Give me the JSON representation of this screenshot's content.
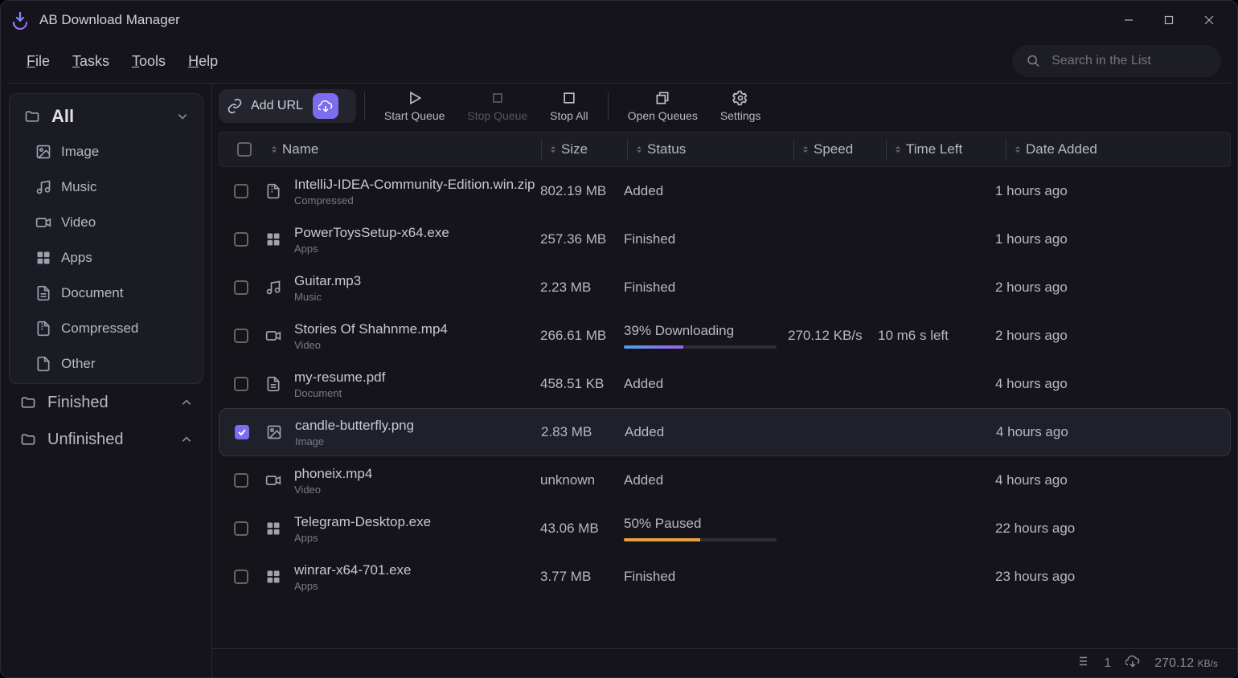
{
  "app": {
    "title": "AB Download Manager"
  },
  "menu": [
    "File",
    "Tasks",
    "Tools",
    "Help"
  ],
  "search": {
    "placeholder": "Search in the List"
  },
  "sidebar": {
    "all": "All",
    "cats": [
      {
        "label": "Image"
      },
      {
        "label": "Music"
      },
      {
        "label": "Video"
      },
      {
        "label": "Apps"
      },
      {
        "label": "Document"
      },
      {
        "label": "Compressed"
      },
      {
        "label": "Other"
      }
    ],
    "groups": [
      {
        "label": "Finished"
      },
      {
        "label": "Unfinished"
      }
    ]
  },
  "toolbar": {
    "addUrl": "Add URL",
    "startQueue": "Start Queue",
    "stopQueue": "Stop Queue",
    "stopAll": "Stop All",
    "openQueues": "Open Queues",
    "settings": "Settings"
  },
  "table": {
    "headers": {
      "name": "Name",
      "size": "Size",
      "status": "Status",
      "speed": "Speed",
      "time": "Time Left",
      "date": "Date Added"
    }
  },
  "rows": [
    {
      "name": "IntelliJ-IDEA-Community-Edition.win.zip",
      "category": "Compressed",
      "iconType": "compressed",
      "size": "802.19 MB",
      "status": "Added",
      "speed": "",
      "time": "",
      "date": "1 hours ago",
      "selected": false
    },
    {
      "name": "PowerToysSetup-x64.exe",
      "category": "Apps",
      "iconType": "apps",
      "size": "257.36 MB",
      "status": "Finished",
      "speed": "",
      "time": "",
      "date": "1 hours ago",
      "selected": false
    },
    {
      "name": "Guitar.mp3",
      "category": "Music",
      "iconType": "music",
      "size": "2.23 MB",
      "status": "Finished",
      "speed": "",
      "time": "",
      "date": "2 hours ago",
      "selected": false
    },
    {
      "name": "Stories Of Shahnme.mp4",
      "category": "Video",
      "iconType": "video",
      "size": "266.61 MB",
      "status": "39% Downloading",
      "progress": 39,
      "progressType": "dl",
      "speed": "270.12 KB/s",
      "time": "10 m6 s left",
      "date": "2 hours ago",
      "selected": false
    },
    {
      "name": "my-resume.pdf",
      "category": "Document",
      "iconType": "document",
      "size": "458.51 KB",
      "status": "Added",
      "speed": "",
      "time": "",
      "date": "4 hours ago",
      "selected": false
    },
    {
      "name": "candle-butterfly.png",
      "category": "Image",
      "iconType": "image",
      "size": "2.83 MB",
      "status": "Added",
      "speed": "",
      "time": "",
      "date": "4 hours ago",
      "selected": true
    },
    {
      "name": "phoneix.mp4",
      "category": "Video",
      "iconType": "video",
      "size": "unknown",
      "status": "Added",
      "speed": "",
      "time": "",
      "date": "4 hours ago",
      "selected": false
    },
    {
      "name": "Telegram-Desktop.exe",
      "category": "Apps",
      "iconType": "apps",
      "size": "43.06 MB",
      "status": "50% Paused",
      "progress": 50,
      "progressType": "paused",
      "speed": "",
      "time": "",
      "date": "22 hours ago",
      "selected": false
    },
    {
      "name": "winrar-x64-701.exe",
      "category": "Apps",
      "iconType": "apps",
      "size": "3.77 MB",
      "status": "Finished",
      "speed": "",
      "time": "",
      "date": "23 hours ago",
      "selected": false
    }
  ],
  "statusBar": {
    "selected": "1",
    "speed": "270.12",
    "unit": "KB/s"
  }
}
